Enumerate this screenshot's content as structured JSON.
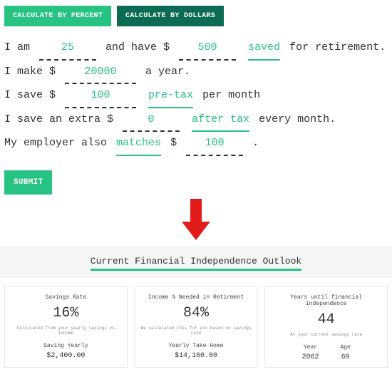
{
  "tabs": {
    "percent": "CALCULATE BY PERCENT",
    "dollars": "CALCULATE BY DOLLARS"
  },
  "form": {
    "t_iam": "I am ",
    "age": "25",
    "t_have": " and have $ ",
    "saved": "500",
    "link_saved": "saved",
    "t_for_ret": " for retirement.",
    "t_make": "I make $ ",
    "income": "20000",
    "t_ayear": " a year.",
    "t_isave": "I save $ ",
    "pretax": "100",
    "link_pretax": "pre-tax",
    "t_permonth": " per month",
    "t_extra": "I save an extra $ ",
    "aftertax": "0",
    "link_aftertax": "after tax",
    "t_everymonth": " every month.",
    "t_employer": "My employer also ",
    "link_matches": "matches",
    "t_dollar": " $ ",
    "match": "100",
    "t_period": " ."
  },
  "submit": "SUBMIT",
  "outlook_title": "Current Financial Independence Outlook",
  "cards": {
    "rate": {
      "h": "Savings Rate",
      "v": "16%",
      "sub": "Calculated from your yearly savings vs income",
      "fh": "Saving Yearly",
      "fv": "$2,400.00"
    },
    "needed": {
      "h": "Income % Needed in Retirment",
      "v": "84%",
      "sub": "We calculated this for you based on savings rate",
      "fh": "Yearly Take Home",
      "fv": "$14,100.00"
    },
    "years": {
      "h": "Years until financial independence",
      "v": "44",
      "sub": "At your current savings rate",
      "yh": "Year",
      "yv": "2062",
      "ah": "Age",
      "av": "69"
    }
  }
}
